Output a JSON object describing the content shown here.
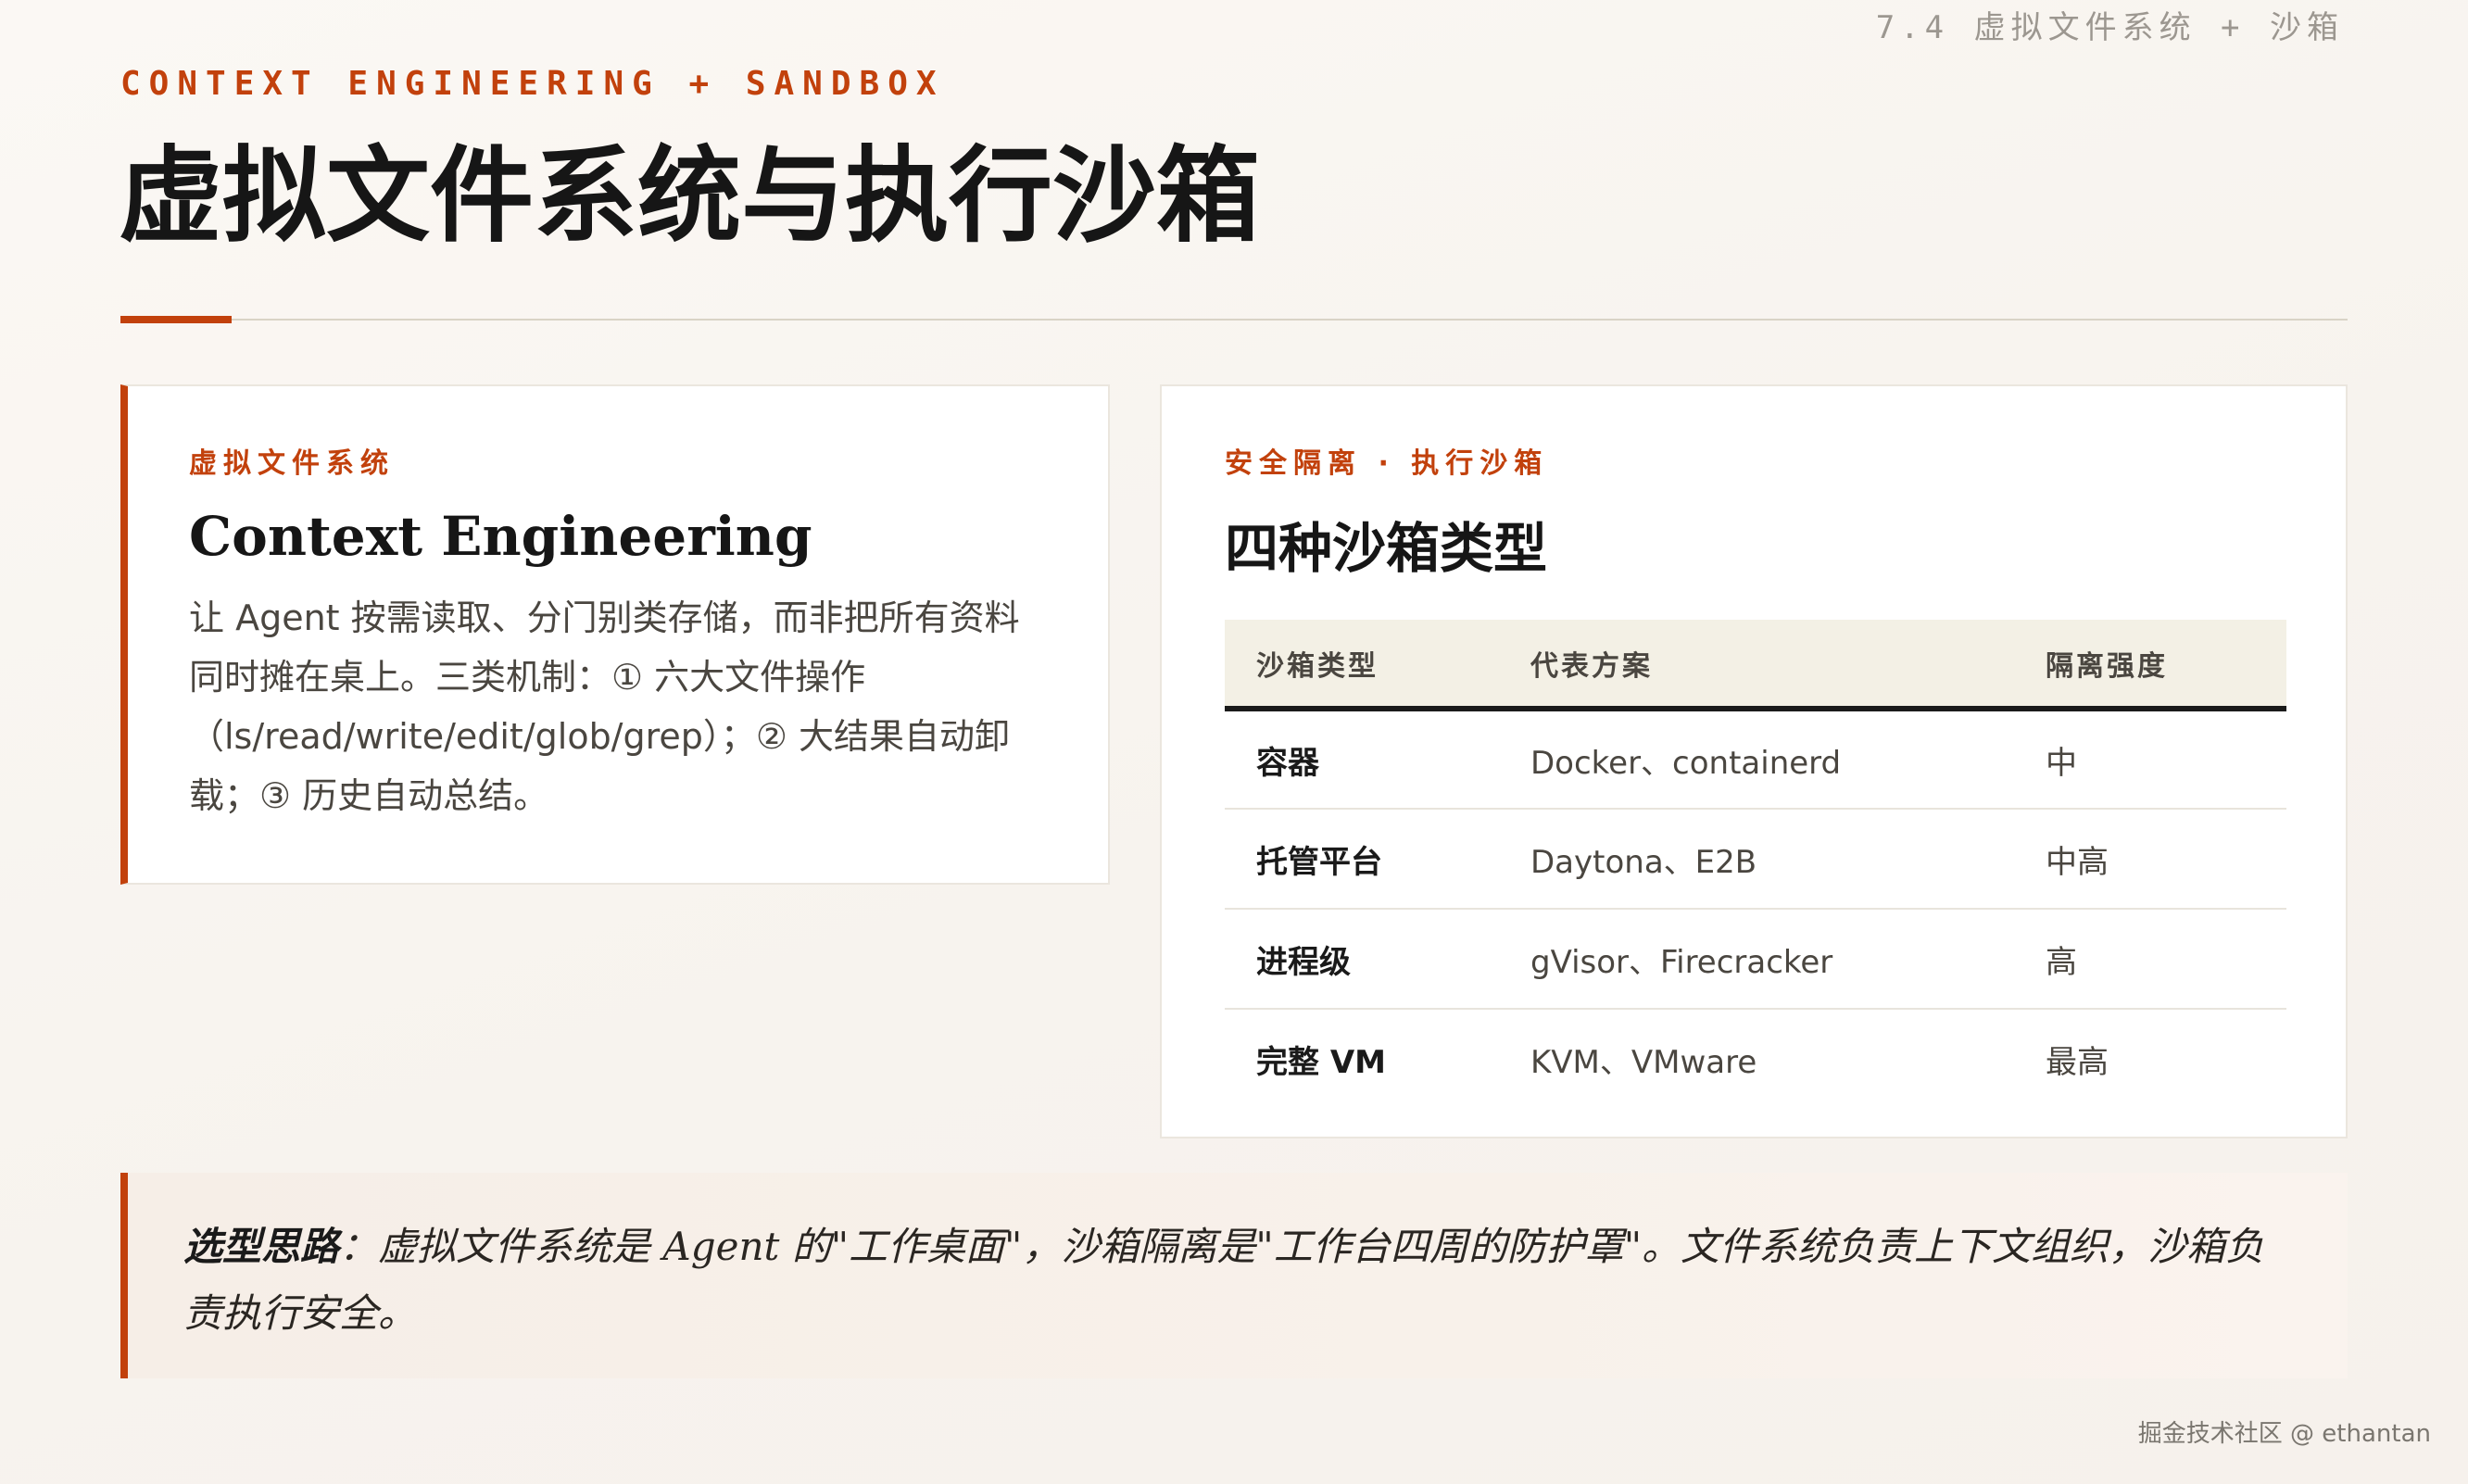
{
  "header": {
    "page_label": "7.4 虚拟文件系统 + 沙箱",
    "eyebrow": "CONTEXT ENGINEERING + SANDBOX",
    "title": "虚拟文件系统与执行沙箱"
  },
  "left_card": {
    "eyebrow": "虚拟文件系统",
    "title": "Context Engineering",
    "body": "让 Agent 按需读取、分门别类存储，而非把所有资料同时摊在桌上。三类机制：① 六大文件操作（ls/read/write/edit/glob/grep）；② 大结果自动卸载；③ 历史自动总结。"
  },
  "right_card": {
    "eyebrow": "安全隔离 · 执行沙箱",
    "title": "四种沙箱类型",
    "table": {
      "headers": [
        "沙箱类型",
        "代表方案",
        "隔离强度"
      ],
      "rows": [
        [
          "容器",
          "Docker、containerd",
          "中"
        ],
        [
          "托管平台",
          "Daytona、E2B",
          "中高"
        ],
        [
          "进程级",
          "gVisor、Firecracker",
          "高"
        ],
        [
          "完整 VM",
          "KVM、VMware",
          "最高"
        ]
      ]
    }
  },
  "note": {
    "lead": "选型思路",
    "separator": "：",
    "text": "虚拟文件系统是 Agent 的\"工作桌面\"，沙箱隔离是\"工作台四周的防护罩\"。文件系统负责上下文组织，沙箱负责执行安全。"
  },
  "footer": {
    "watermark": "掘金技术社区 @ ethantan"
  },
  "colors": {
    "accent": "#c2410c",
    "table_header_bg": "#f3f0e5",
    "note_bg": "#f6eee7"
  }
}
